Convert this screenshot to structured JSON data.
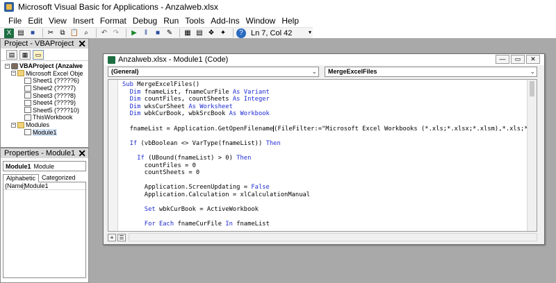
{
  "window": {
    "title": "Microsoft Visual Basic for Applications - Anzalweb.xlsx"
  },
  "menu": [
    "File",
    "Edit",
    "View",
    "Insert",
    "Format",
    "Debug",
    "Run",
    "Tools",
    "Add-Ins",
    "Window",
    "Help"
  ],
  "toolbar": {
    "status": "Ln 7, Col 42"
  },
  "project": {
    "title": "Project - VBAProject",
    "tree": [
      {
        "label": "VBAProject (Anzalwe",
        "toggle": "−"
      },
      {
        "label": "Microsoft Excel Obje",
        "toggle": "−"
      },
      {
        "label": "Sheet1 (?????6)"
      },
      {
        "label": "Sheet2 (????7)"
      },
      {
        "label": "Sheet3 (????8)"
      },
      {
        "label": "Sheet4 (????9)"
      },
      {
        "label": "Sheet5 (????10)"
      },
      {
        "label": "ThisWorkbook"
      },
      {
        "label": "Modules",
        "toggle": "−"
      },
      {
        "label": "Module1"
      }
    ]
  },
  "properties": {
    "title": "Properties - Module1",
    "object_name": "Module1",
    "object_type": "Module",
    "tabs": [
      "Alphabetic",
      "Categorized"
    ],
    "row": {
      "name": "(Name)",
      "value": "Module1"
    }
  },
  "code_window": {
    "title": "Anzalweb.xlsx - Module1 (Code)",
    "object_combo": "(General)",
    "proc_combo": "MergeExcelFiles",
    "lines": [
      "Sub MergeExcelFiles()",
      "  Dim fnameList, fnameCurFile As Variant",
      "  Dim countFiles, countSheets As Integer",
      "  Dim wksCurSheet As Worksheet",
      "  Dim wbkCurBook, wbkSrcBook As Workbook",
      "",
      "  fnameList = Application.GetOpenFilename(FileFilter:=\"Microsoft Excel Workbooks (*.xls;*.xlsx;*.xlsm),*.xls;*",
      "",
      "  If (vbBoolean <> VarType(fnameList)) Then",
      "",
      "    If (UBound(fnameList) > 0) Then",
      "      countFiles = 0",
      "      countSheets = 0",
      "",
      "      Application.ScreenUpdating = False",
      "      Application.Calculation = xlCalculationManual",
      "",
      "      Set wbkCurBook = ActiveWorkbook",
      "",
      "      For Each fnameCurFile In fnameList"
    ]
  }
}
